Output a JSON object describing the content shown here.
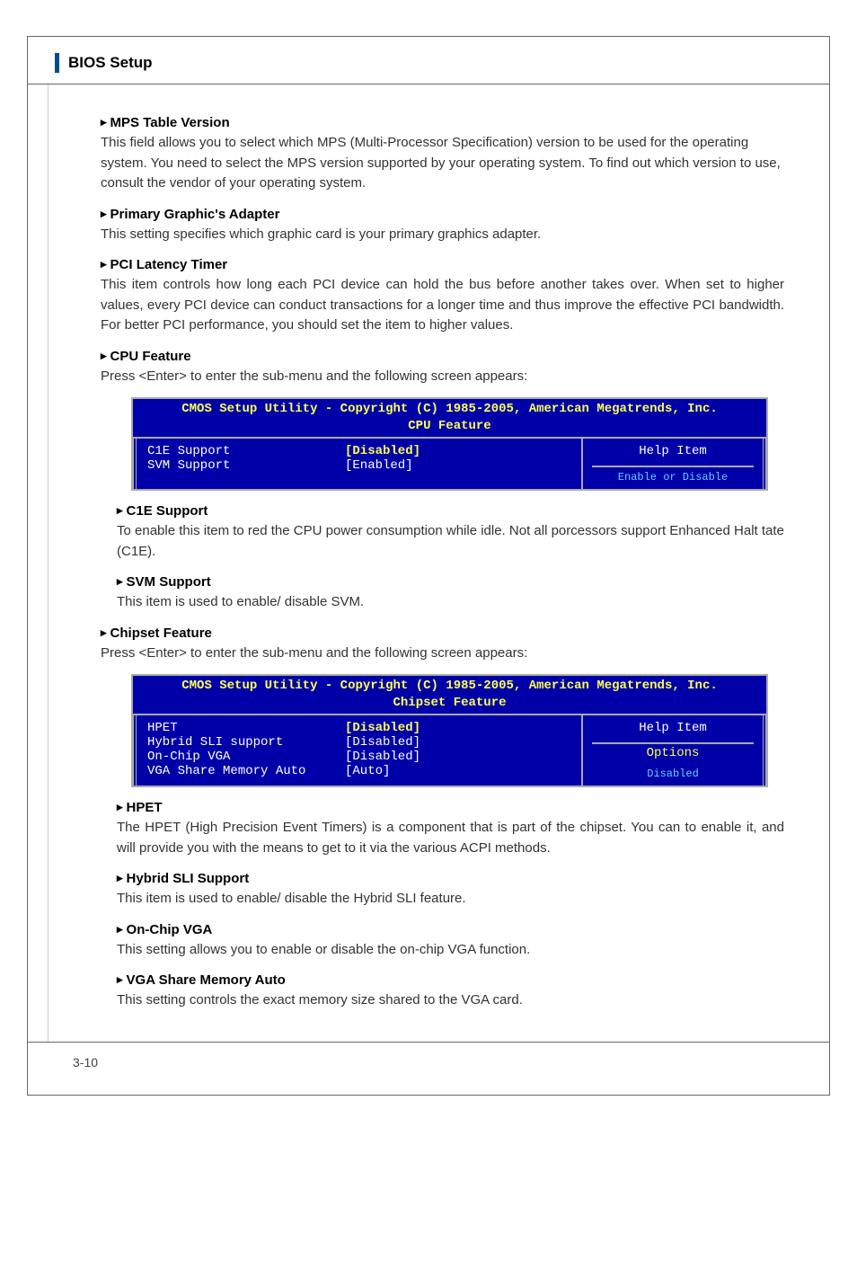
{
  "chapter_title": "BIOS Setup",
  "sections": {
    "mps": {
      "heading": "MPS Table Version",
      "body": "This field allows you to select which MPS (Multi-Processor Specification) version to be used for the operating system. You need to select the MPS version supported by your operating system. To find out which version to use, consult the vendor of your operating system."
    },
    "primary_graphic": {
      "heading": "Primary Graphic's Adapter",
      "body": "This setting specifies which graphic card is your primary graphics adapter."
    },
    "pci_latency": {
      "heading": "PCI Latency Timer",
      "body": "This item controls how long each PCI device can hold the bus before another takes over. When set to higher values, every PCI device can conduct transactions for a longer time and thus improve the effective PCI bandwidth. For better PCI performance, you should set the item to higher values."
    },
    "cpu_feature": {
      "heading": "CPU Feature",
      "body": "Press <Enter> to enter the sub-menu and the following screen appears:"
    },
    "c1e": {
      "heading": "C1E Support",
      "body": "To enable this item to red the CPU power consumption while idle. Not all porcessors support Enhanced Halt tate (C1E)."
    },
    "svm": {
      "heading": "SVM Support",
      "body": "This item is used to enable/ disable SVM."
    },
    "chipset": {
      "heading": "Chipset Feature",
      "body": "Press <Enter> to enter the sub-menu and the following screen appears:"
    },
    "hpet": {
      "heading": "HPET",
      "body": "The HPET (High Precision Event Timers) is a component that is part of the chipset. You can to enable it, and will provide you with the means to get to it via the various ACPI methods."
    },
    "hybrid_sli": {
      "heading": "Hybrid SLI Support",
      "body": "This item is used to enable/ disable the Hybrid SLI feature."
    },
    "on_chip_vga": {
      "heading": "On-Chip VGA",
      "body": "This setting allows you to enable or disable the on-chip VGA function."
    },
    "vga_share": {
      "heading": "VGA Share Memory Auto",
      "body": "This setting controls the exact memory size shared to the VGA card."
    }
  },
  "bios_cpu": {
    "title": "CMOS Setup Utility - Copyright (C) 1985-2005, American Megatrends, Inc.",
    "subtitle": "CPU Feature",
    "rows": [
      {
        "label": "C1E Support",
        "value": "[Disabled]",
        "highlight": true
      },
      {
        "label": "SVM Support",
        "value": "[Enabled]",
        "highlight": false
      }
    ],
    "help_label": "Help Item",
    "partial": "Enable or Disable"
  },
  "bios_chipset": {
    "title": "CMOS Setup Utility - Copyright (C) 1985-2005, American Megatrends, Inc.",
    "subtitle": "Chipset Feature",
    "rows": [
      {
        "label": "HPET",
        "value": "[Disabled]",
        "highlight": true
      },
      {
        "label": "Hybrid SLI support",
        "value": "[Disabled]",
        "highlight": false
      },
      {
        "label": "On-Chip VGA",
        "value": "[Disabled]",
        "highlight": false
      },
      {
        "label": "VGA Share Memory Auto",
        "value": "[Auto]",
        "highlight": false
      }
    ],
    "help_label": "Help Item",
    "options_label": "Options",
    "partial": "Disabled"
  },
  "page_number": "3-10"
}
